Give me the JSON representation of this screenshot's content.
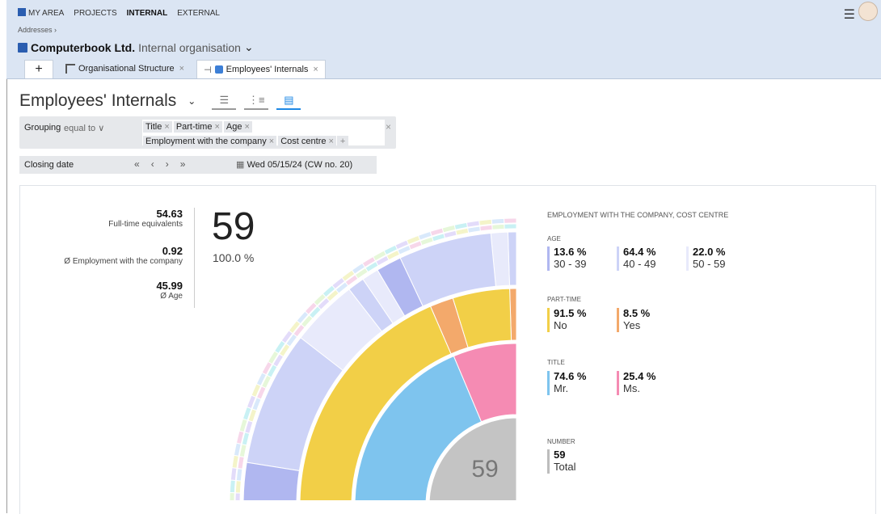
{
  "nav": {
    "items": [
      "MY AREA",
      "PROJECTS",
      "INTERNAL",
      "EXTERNAL"
    ]
  },
  "breadcrumb": "Addresses ›",
  "org": {
    "name": "Computerbook Ltd.",
    "context": "Internal organisation"
  },
  "tabs": [
    {
      "label": "Organisational Structure"
    },
    {
      "label": "Employees' Internals"
    }
  ],
  "page": {
    "title": "Employees' Internals"
  },
  "filter": {
    "label": "Grouping",
    "operator": "equal to",
    "chips": [
      "Title",
      "Part-time",
      "Age",
      "Employment with the company",
      "Cost centre"
    ]
  },
  "date": {
    "label": "Closing date",
    "value": "Wed 05/15/24 (CW no. 20)"
  },
  "kpis": [
    {
      "value": "54.63",
      "label": "Full-time equivalents"
    },
    {
      "value": "0.92",
      "label": "Ø Employment with the company"
    },
    {
      "value": "45.99",
      "label": "Ø Age"
    }
  ],
  "total": {
    "count": "59",
    "percent": "100.0 %"
  },
  "legend": {
    "header": "EMPLOYMENT WITH THE COMPANY, COST CENTRE",
    "age": {
      "title": "AGE",
      "items": [
        {
          "pct": "13.6 %",
          "label": "30 - 39",
          "color": "#b0b7f0"
        },
        {
          "pct": "64.4 %",
          "label": "40 - 49",
          "color": "#cdd3f7"
        },
        {
          "pct": "22.0 %",
          "label": "50 - 59",
          "color": "#e8eafb"
        }
      ]
    },
    "parttime": {
      "title": "PART-TIME",
      "items": [
        {
          "pct": "91.5 %",
          "label": "No",
          "color": "#f2cf47"
        },
        {
          "pct": "8.5 %",
          "label": "Yes",
          "color": "#f3a96b"
        }
      ]
    },
    "title": {
      "title": "TITLE",
      "items": [
        {
          "pct": "74.6 %",
          "label": "Mr.",
          "color": "#7ec4ee"
        },
        {
          "pct": "25.4 %",
          "label": "Ms.",
          "color": "#f58bb3"
        }
      ]
    },
    "number": {
      "title": "NUMBER",
      "items": [
        {
          "pct": "59",
          "label": "Total",
          "color": "#bdbdbd"
        }
      ]
    }
  },
  "chart_data": {
    "type": "sunburst",
    "center_label": "59",
    "rings": [
      {
        "name": "Title",
        "values": [
          74.6,
          25.4
        ],
        "labels": [
          "Mr.",
          "Ms."
        ]
      },
      {
        "name": "Part-time",
        "values": [
          91.5,
          8.5
        ],
        "labels": [
          "No",
          "Yes"
        ]
      },
      {
        "name": "Age",
        "values": [
          13.6,
          64.4,
          22.0
        ],
        "labels": [
          "30 - 39",
          "40 - 49",
          "50 - 59"
        ]
      }
    ]
  }
}
